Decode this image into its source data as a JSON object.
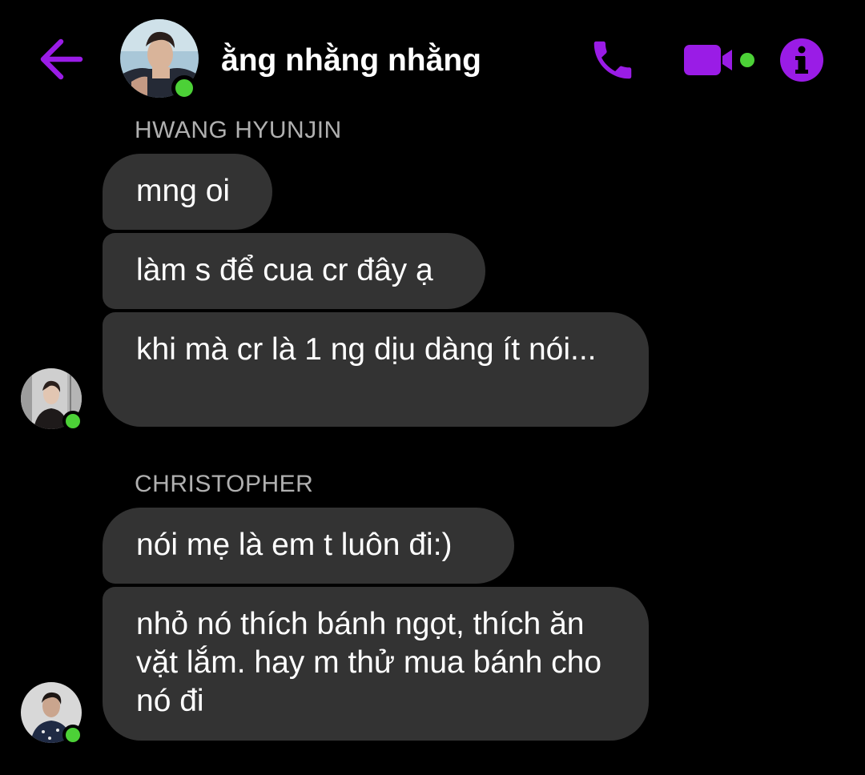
{
  "header": {
    "title": "ằng nhằng nhằng",
    "back_icon": "arrow-left-icon",
    "call_icon": "phone-icon",
    "video_icon": "video-camera-icon",
    "info_icon": "info-icon"
  },
  "colors": {
    "accent": "#9a1ce6",
    "online": "#4cd137",
    "bubble": "#333333",
    "background": "#000000",
    "sender_name": "#b0b0b0"
  },
  "groups": [
    {
      "sender": "HWANG HYUNJIN",
      "messages": [
        "mng oi",
        "làm s để cua cr đây ạ",
        "khi mà cr là 1 ng dịu dàng ít nói..."
      ]
    },
    {
      "sender": "CHRISTOPHER",
      "messages": [
        "nói mẹ là em t luôn đi:)",
        "nhỏ nó thích bánh ngọt, thích ăn vặt lắm. hay m thử mua bánh cho nó đi"
      ]
    }
  ]
}
